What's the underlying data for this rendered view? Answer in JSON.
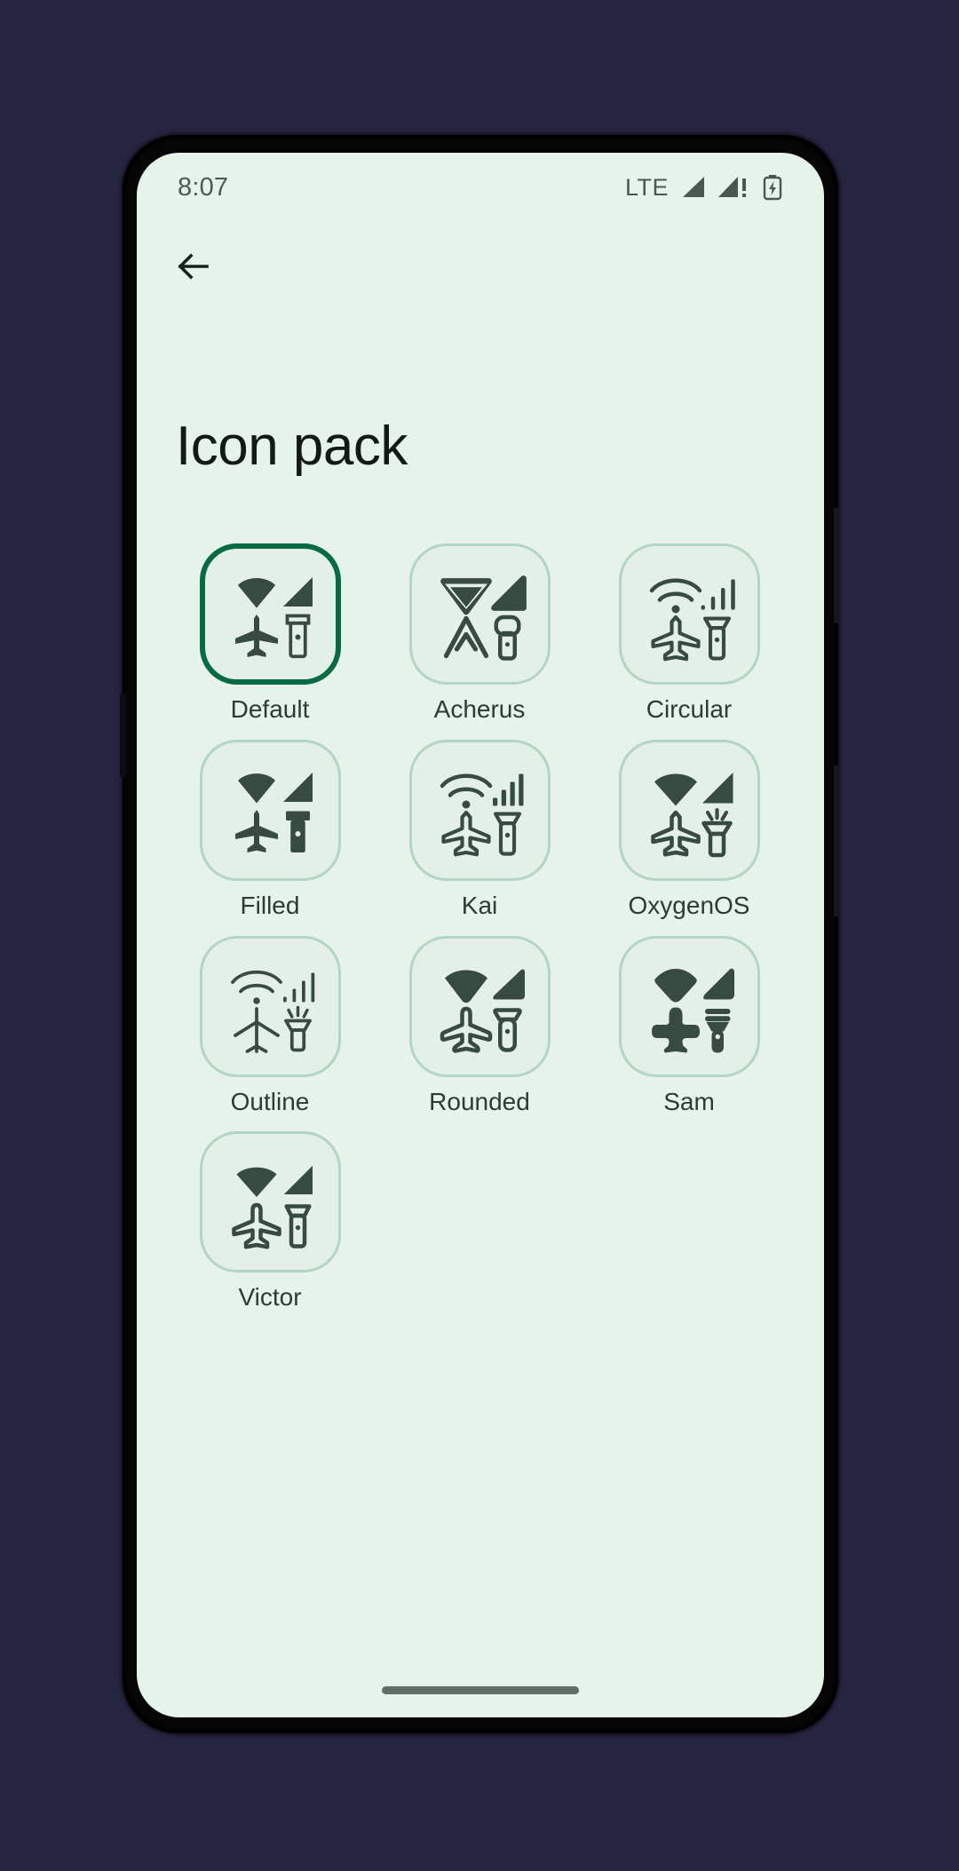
{
  "status_bar": {
    "clock": "8:07",
    "network_label": "LTE",
    "signal_icon": "signal-bars-icon",
    "signal_alert_icon": "signal-bars-alert-icon",
    "battery_icon": "battery-charging-icon"
  },
  "app_bar": {
    "back_icon": "back-arrow-icon"
  },
  "page": {
    "title": "Icon pack"
  },
  "colors": {
    "background_outside": "#272440",
    "screen_background": "#e7f2ea",
    "card_background": "#e3efe7",
    "card_border": "#b2d6c2",
    "selected_border": "#046b42",
    "icon_color": "#374b40",
    "text_primary": "#111a14",
    "text_label": "#2e3a33",
    "status_text": "#4d5a52"
  },
  "icon_packs": [
    {
      "label": "Default",
      "style": "default",
      "selected": true,
      "icons": [
        "wifi-filled-icon",
        "signal-filled-icon",
        "airplane-filled-icon",
        "flashlight-outline-icon"
      ]
    },
    {
      "label": "Acherus",
      "style": "acherus",
      "selected": false,
      "icons": [
        "wifi-angular-icon",
        "signal-angular-icon",
        "airplane-angular-icon",
        "flashlight-angular-icon"
      ]
    },
    {
      "label": "Circular",
      "style": "circular",
      "selected": false,
      "icons": [
        "wifi-arcs-icon",
        "signal-bars-outline-icon",
        "airplane-outline-icon",
        "flashlight-outline-icon"
      ]
    },
    {
      "label": "Filled",
      "style": "filled",
      "selected": false,
      "icons": [
        "wifi-filled-icon",
        "signal-filled-icon",
        "airplane-filled-icon",
        "flashlight-filled-icon"
      ]
    },
    {
      "label": "Kai",
      "style": "kai",
      "selected": false,
      "icons": [
        "wifi-arcs-icon",
        "signal-bars-slanted-icon",
        "airplane-outline-icon",
        "flashlight-outline-icon"
      ]
    },
    {
      "label": "OxygenOS",
      "style": "oxygenos",
      "selected": false,
      "icons": [
        "wifi-filled-icon",
        "signal-filled-icon",
        "airplane-outline-icon",
        "flashlight-rays-icon"
      ]
    },
    {
      "label": "Outline",
      "style": "outline",
      "selected": false,
      "icons": [
        "wifi-arcs-icon",
        "signal-bars-outline-icon",
        "airplane-line-icon",
        "flashlight-rays-outline-icon"
      ]
    },
    {
      "label": "Rounded",
      "style": "rounded",
      "selected": false,
      "icons": [
        "wifi-filled-icon",
        "signal-filled-icon",
        "airplane-outline-icon",
        "flashlight-outline-icon"
      ]
    },
    {
      "label": "Sam",
      "style": "sam",
      "selected": false,
      "icons": [
        "wifi-filled-icon",
        "signal-filled-icon",
        "airplane-chubby-icon",
        "flashlight-chubby-icon"
      ]
    },
    {
      "label": "Victor",
      "style": "victor",
      "selected": false,
      "icons": [
        "wifi-filled-icon",
        "signal-filled-icon",
        "airplane-outline-icon",
        "flashlight-outline-icon"
      ]
    }
  ],
  "gesture_bar": {
    "name": "home-gesture-bar"
  }
}
